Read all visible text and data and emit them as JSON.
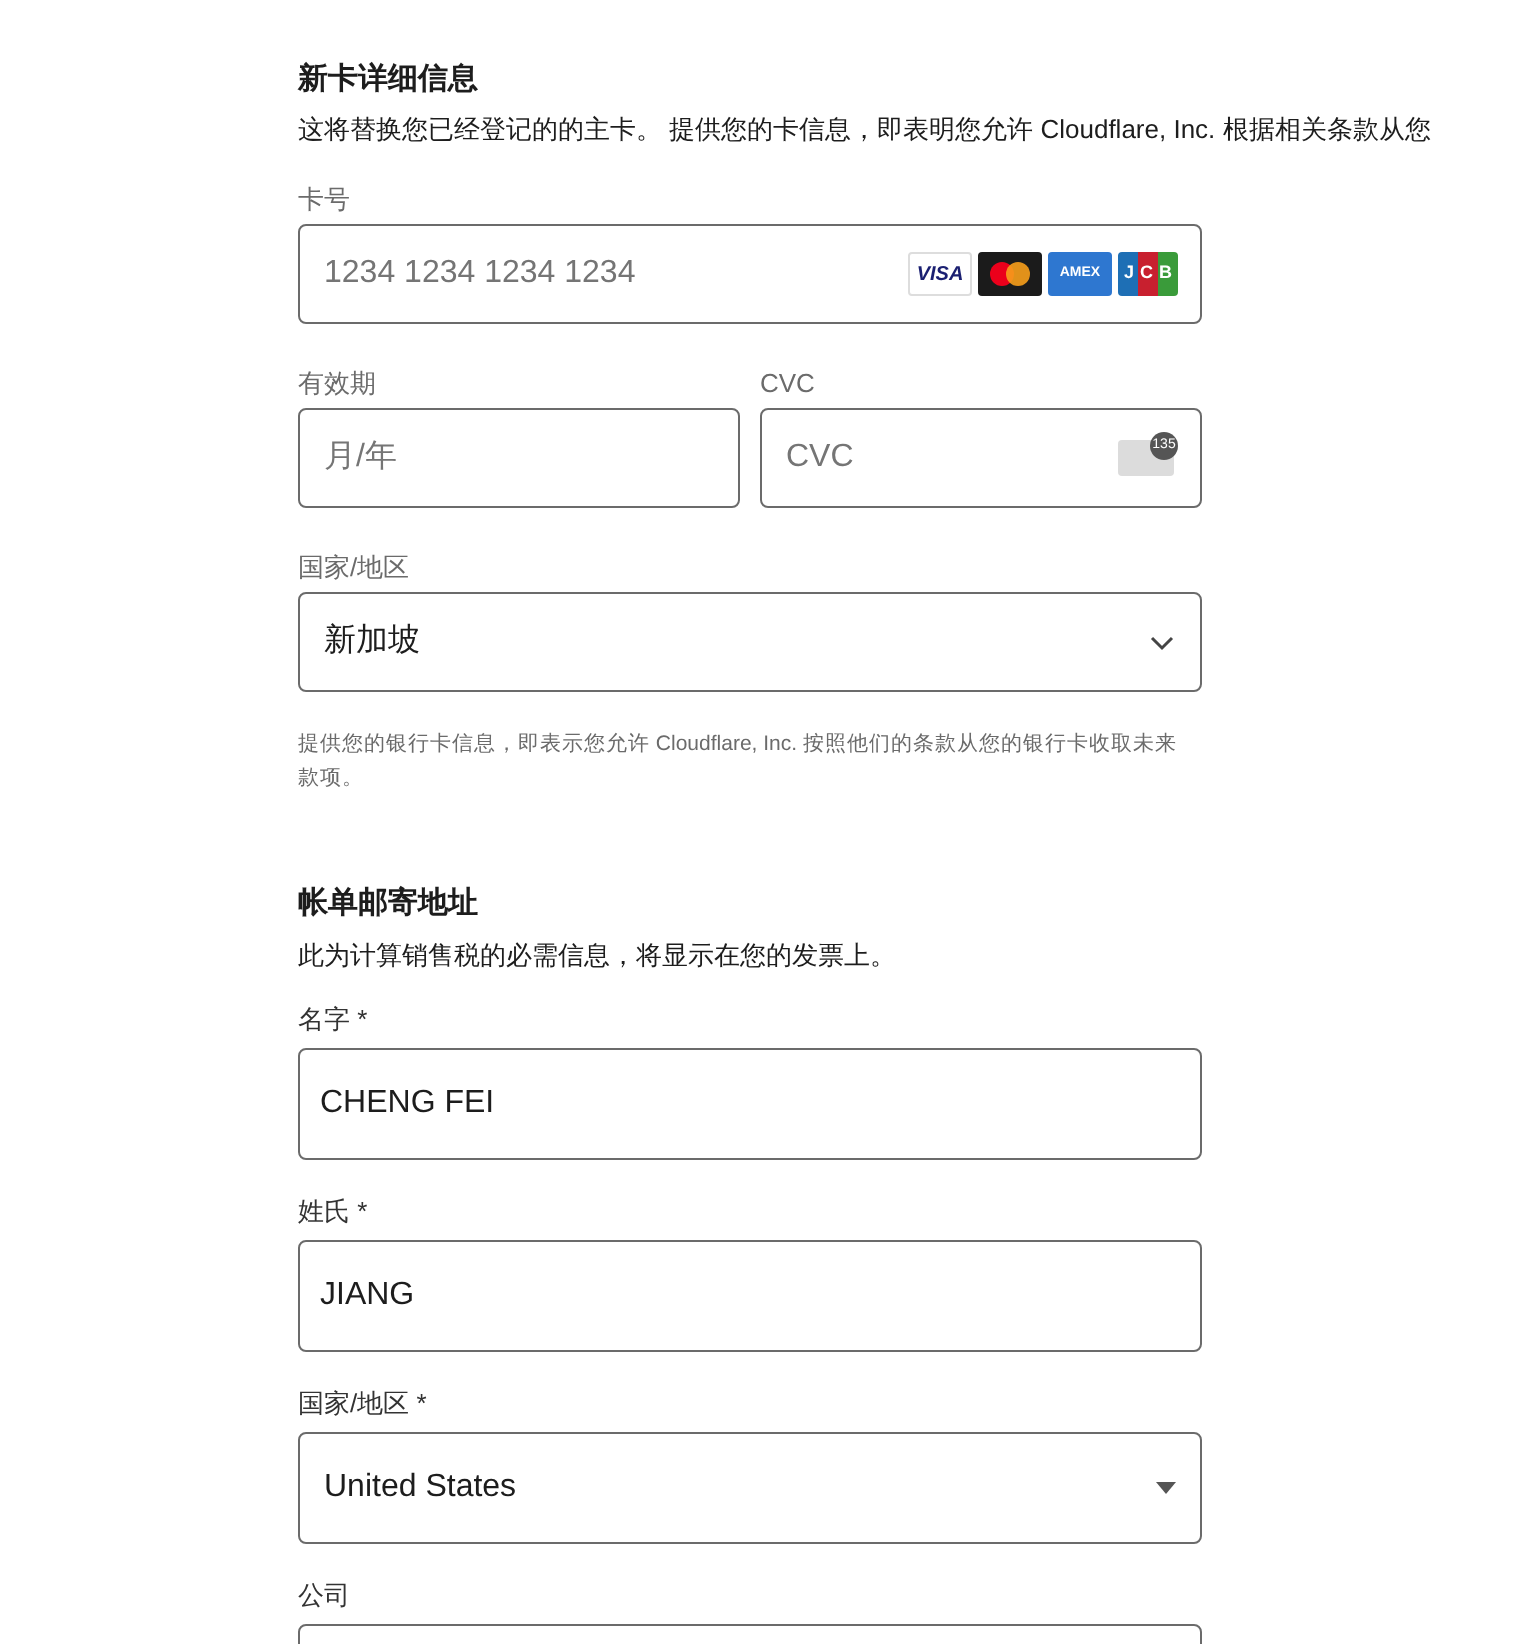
{
  "card_section": {
    "title": "新卡详细信息",
    "description": "这将替换您已经登记的的主卡。 提供您的卡信息，即表明您允许 Cloudflare, Inc. 根据相关条款从您",
    "card_number": {
      "label": "卡号",
      "placeholder": "1234 1234 1234 1234",
      "brands": [
        {
          "kind": "visa",
          "text": "VISA"
        },
        {
          "kind": "mastercard"
        },
        {
          "kind": "amex",
          "text": "AMEX"
        },
        {
          "kind": "jcb",
          "text": "JCB"
        }
      ]
    },
    "expiry": {
      "label": "有效期",
      "placeholder": "月/年"
    },
    "cvc": {
      "label": "CVC",
      "placeholder": "CVC",
      "badge": "135"
    },
    "country": {
      "label": "国家/地区",
      "value": "新加坡"
    },
    "note": "提供您的银行卡信息，即表示您允许 Cloudflare, Inc. 按照他们的条款从您的银行卡收取未来款项。"
  },
  "billing_section": {
    "title": "帐单邮寄地址",
    "description": "此为计算销售税的必需信息，将显示在您的发票上。",
    "fields": [
      {
        "kind": "text",
        "label": "名字 *",
        "value": "CHENG FEI"
      },
      {
        "kind": "text",
        "label": "姓氏 *",
        "value": "JIANG"
      },
      {
        "kind": "select",
        "label": "国家/地区 *",
        "value": "United States"
      },
      {
        "kind": "text",
        "label": "公司"
      }
    ]
  }
}
